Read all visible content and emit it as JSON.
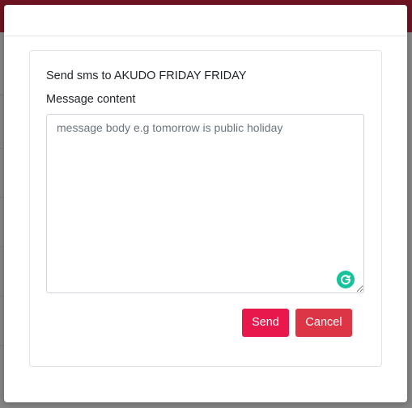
{
  "modal": {
    "title": "Send sms to AKUDO FRIDAY FRIDAY",
    "message_label": "Message content",
    "message_value": "",
    "message_placeholder": "message body e.g tomorrow is public holiday",
    "send_label": "Send",
    "cancel_label": "Cancel"
  },
  "colors": {
    "topbar": "#6e1422",
    "send_button": "#e8184d",
    "cancel_button": "#dc3545",
    "grammarly": "#15c39a"
  },
  "icons": {
    "grammarly": "grammarly-icon"
  }
}
